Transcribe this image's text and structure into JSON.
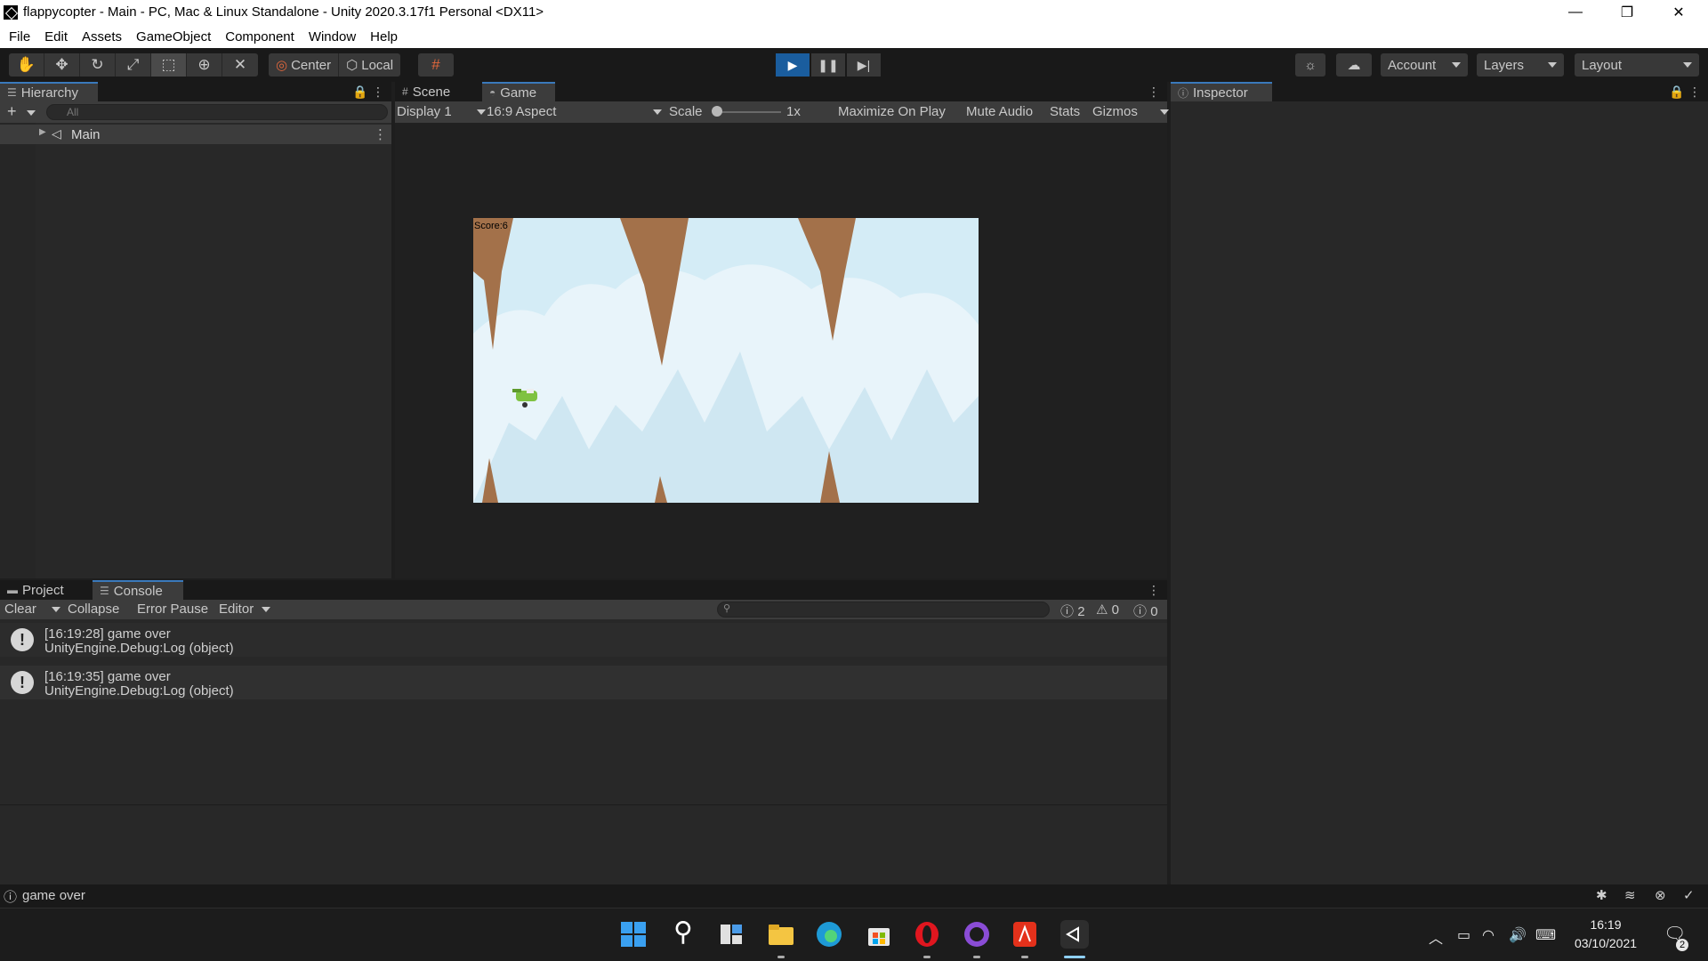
{
  "window": {
    "title": "flappycopter - Main - PC, Mac & Linux Standalone - Unity 2020.3.17f1 Personal <DX11>",
    "controls": [
      "—",
      "❐",
      "✕"
    ]
  },
  "menu": [
    "File",
    "Edit",
    "Assets",
    "GameObject",
    "Component",
    "Window",
    "Help"
  ],
  "toolbar": {
    "tools": [
      "hand-icon",
      "move-icon",
      "rotate-icon",
      "scale-icon",
      "rect-icon",
      "transform-icon",
      "custom-tool-icon"
    ],
    "pivot_mode": "Center",
    "pivot_rotation": "Local",
    "play_state": "playing",
    "account": "Account",
    "layers": "Layers",
    "layout": "Layout"
  },
  "hierarchy": {
    "tab": "Hierarchy",
    "search_placeholder": "All",
    "scene": "Main"
  },
  "game_view": {
    "tabs": [
      "Scene",
      "Game"
    ],
    "active_tab": "Game",
    "display": "Display 1",
    "aspect": "16:9 Aspect",
    "scale_label": "Scale",
    "scale_value": "1x",
    "buttons": [
      "Maximize On Play",
      "Mute Audio",
      "Stats",
      "Gizmos"
    ],
    "score": "Score:6"
  },
  "inspector": {
    "tab": "Inspector"
  },
  "console": {
    "tabs": [
      "Project",
      "Console"
    ],
    "active_tab": "Console",
    "toolbar": [
      "Clear",
      "Collapse",
      "Error Pause",
      "Editor"
    ],
    "counts": {
      "logs": "2",
      "warnings": "0",
      "errors": "0"
    },
    "entries": [
      {
        "line1": "[16:19:28] game over",
        "line2": "UnityEngine.Debug:Log (object)"
      },
      {
        "line1": "[16:19:35] game over",
        "line2": "UnityEngine.Debug:Log (object)"
      }
    ]
  },
  "status": {
    "message": "game over"
  },
  "taskbar": {
    "time": "16:19",
    "date": "03/10/2021",
    "notifications": "2",
    "colors": {
      "accent": "#3a79bb",
      "play": "#1a5d9e"
    }
  }
}
